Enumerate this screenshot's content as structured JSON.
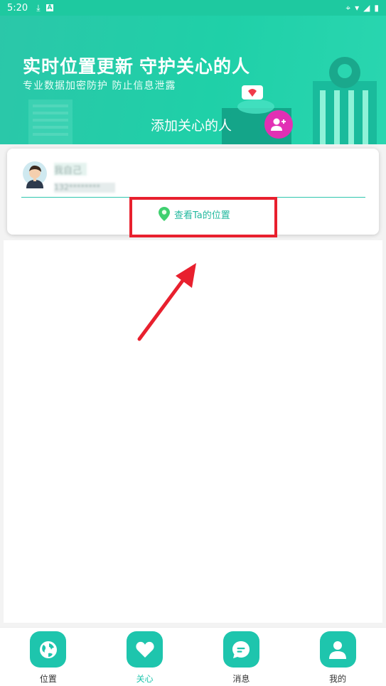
{
  "status_bar": {
    "time": "5:20",
    "icons_left": [
      "download-icon",
      "a-badge-icon"
    ],
    "icons_right": [
      "location-icon",
      "wifi-icon",
      "signal-icon",
      "battery-icon"
    ]
  },
  "banner": {
    "title": "实时位置更新 守护关心的人",
    "subtitle": "专业数据加密防护 防止信息泄露",
    "add_label": "添加关心的人",
    "add_icon": "add-person-icon"
  },
  "contact_card": {
    "name": "我自己",
    "phone": "132********",
    "view_location_label": "查看Ta的位置",
    "view_location_icon": "map-pin-icon"
  },
  "bottom_nav": {
    "items": [
      {
        "label": "位置",
        "icon": "globe-icon",
        "active": false
      },
      {
        "label": "关心",
        "icon": "heart-icon",
        "active": true
      },
      {
        "label": "消息",
        "icon": "chat-icon",
        "active": false
      },
      {
        "label": "我的",
        "icon": "user-icon",
        "active": false
      }
    ]
  },
  "colors": {
    "accent": "#1ec5ad",
    "banner_start": "#2bc7a9",
    "add_button": "#e230b4",
    "annotation": "#e8202e"
  }
}
